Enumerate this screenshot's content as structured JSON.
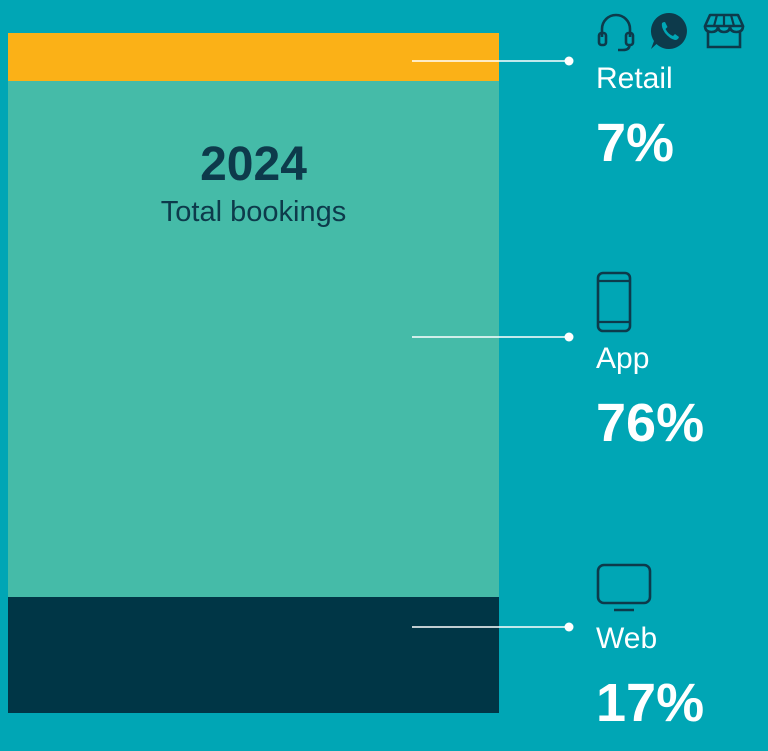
{
  "chart_data": {
    "type": "bar",
    "stacked": true,
    "title": "2024",
    "subtitle": "Total bookings",
    "series": [
      {
        "name": "Retail",
        "value": 7,
        "label": "7%",
        "color": "#FBB117",
        "icons": [
          "headset-icon",
          "whatsapp-icon",
          "store-icon"
        ]
      },
      {
        "name": "App",
        "value": 76,
        "label": "76%",
        "color": "#45BBA8",
        "icons": [
          "smartphone-icon"
        ]
      },
      {
        "name": "Web",
        "value": 17,
        "label": "17%",
        "color": "#003646",
        "icons": [
          "monitor-icon"
        ]
      }
    ]
  },
  "colors": {
    "background": "#00A6B5",
    "title_text": "#0D3A4B",
    "legend_text": "#FFFFFF",
    "connector": "#FFFFFF",
    "icon_stroke": "#0D3A4B"
  }
}
